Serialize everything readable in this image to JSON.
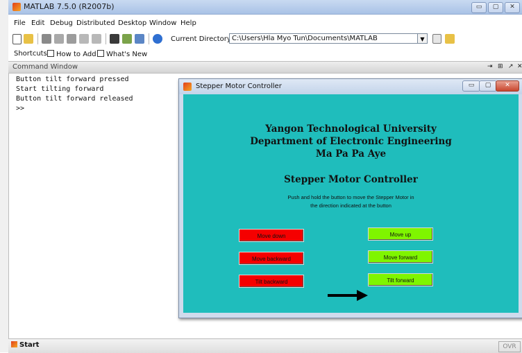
{
  "window": {
    "title": "MATLAB 7.5.0 (R2007b)",
    "controls": [
      "▭",
      "▢",
      "✕"
    ]
  },
  "menu": [
    "File",
    "Edit",
    "Debug",
    "Distributed",
    "Desktop",
    "Window",
    "Help"
  ],
  "toolbar": {
    "current_directory_label": "Current Directory:",
    "current_directory_value": "C:\\Users\\Hla Myo Tun\\Documents\\MATLAB",
    "icons": [
      "new-file-icon",
      "open-folder-icon",
      "cut-icon",
      "copy-icon",
      "paste-icon",
      "undo-icon",
      "redo-icon",
      "simulink-icon",
      "guide-icon",
      "profiler-icon",
      "help-icon"
    ]
  },
  "shortcuts": {
    "label": "Shortcuts",
    "items": [
      "How to Add",
      "What's New"
    ]
  },
  "command_window": {
    "title": "Command Window",
    "lines": [
      "Button tilt forward pressed",
      "Start tilting forward",
      "Button tilt forward released",
      ">>"
    ]
  },
  "figure": {
    "title": "Stepper Motor Controller",
    "heading_lines": [
      "Yangon Technological University",
      "Department of Electronic Engineering",
      "Ma Pa Pa Aye"
    ],
    "subtitle": "Stepper Motor Controller",
    "instructions": [
      "Push and hold the button to move the Stepper Motor in",
      "the direction indicated at the button"
    ],
    "buttons_left": [
      "Move down",
      "Move backward",
      "Tilt backward"
    ],
    "buttons_right": [
      "Move up",
      "Move forward",
      "Tilt forward"
    ],
    "canvas_color": "#1fbdbc",
    "left_button_color": "#f50000",
    "right_button_color": "#7ff500"
  },
  "statusbar": {
    "start_label": "Start",
    "mode": "OVR"
  }
}
